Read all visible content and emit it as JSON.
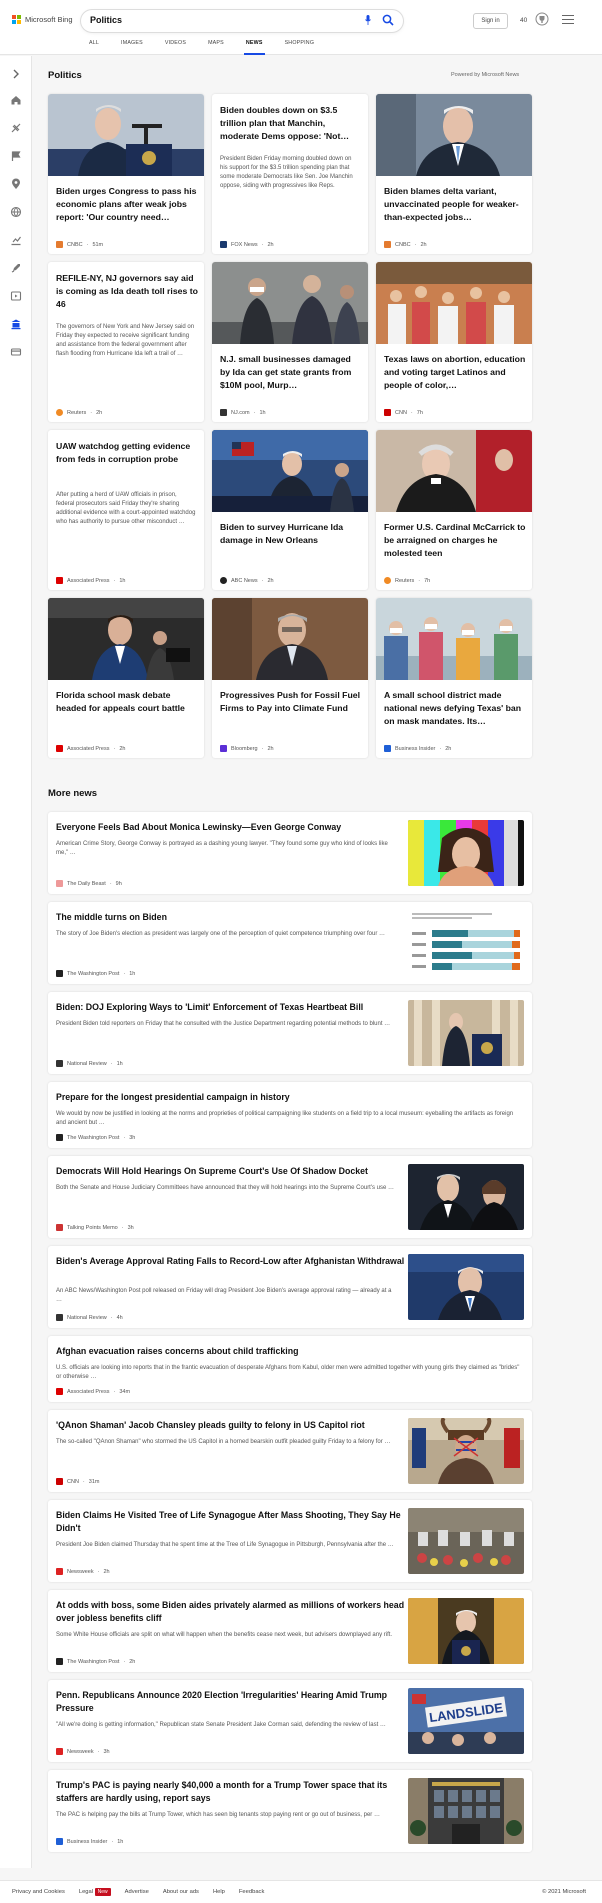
{
  "header": {
    "brand": "Microsoft Bing",
    "query": "Politics",
    "sign_in": "Sign in",
    "points": "40",
    "tabs": [
      "ALL",
      "IMAGES",
      "VIDEOS",
      "MAPS",
      "NEWS",
      "SHOPPING"
    ],
    "active_tab": "NEWS"
  },
  "section_title": "Politics",
  "powered_by": "Powered by Microsoft News",
  "cards": [
    {
      "title": "Biden urges Congress to pass his economic plans after weak jobs report: 'Our country need…",
      "source": "CNBC",
      "time": "51m",
      "icon_color": "#e47b2f"
    },
    {
      "title": "Biden doubles down on $3.5 trillion plan that Manchin, moderate Dems oppose: 'Not…",
      "snippet": "President Biden Friday morning doubled down on his support for the $3.5 trillion spending plan that some moderate Democrats like Sen. Joe Manchin oppose, siding with progressives like Reps.",
      "source": "FOX News",
      "time": "2h",
      "icon_color": "#1a3a6e"
    },
    {
      "title": "Biden blames delta variant, unvaccinated people for weaker-than-expected jobs…",
      "source": "CNBC",
      "time": "2h",
      "icon_color": "#e47b2f"
    },
    {
      "title": "REFILE-NY, NJ governors say aid is coming as Ida death toll rises to 46",
      "snippet": "The governors of New York and New Jersey said on Friday they expected to receive significant funding and assistance from the federal government after flash flooding from Hurricane Ida left a trail of …",
      "source": "Reuters",
      "time": "2h",
      "icon_color": "#f08a24"
    },
    {
      "title": "N.J. small businesses damaged by Ida can get state grants from $10M pool, Murp…",
      "source": "NJ.com",
      "time": "1h",
      "icon_color": "#333"
    },
    {
      "title": "Texas laws on abortion, education and voting target Latinos and people of color,…",
      "source": "CNN",
      "time": "7h",
      "icon_color": "#cc0000"
    },
    {
      "title": "UAW watchdog getting evidence from feds in corruption probe",
      "snippet": "After putting a herd of UAW officials in prison, federal prosecutors said Friday they're sharing additional evidence with a court-appointed watchdog who has authority to pursue other misconduct …",
      "source": "Associated Press",
      "time": "1h",
      "icon_color": "#d00"
    },
    {
      "title": "Biden to survey Hurricane Ida damage in New Orleans",
      "source": "ABC News",
      "time": "2h",
      "icon_color": "#222"
    },
    {
      "title": "Former U.S. Cardinal McCarrick to be arraigned on charges he molested teen",
      "source": "Reuters",
      "time": "7h",
      "icon_color": "#f08a24"
    },
    {
      "title": "Florida school mask debate headed for appeals court battle",
      "source": "Associated Press",
      "time": "2h",
      "icon_color": "#d00"
    },
    {
      "title": "Progressives Push for Fossil Fuel Firms to Pay into Climate Fund",
      "source": "Bloomberg",
      "time": "2h",
      "icon_color": "#5b2fd6"
    },
    {
      "title": "A small school district made national news defying Texas' ban on mask mandates. Its…",
      "source": "Business Insider",
      "time": "2h",
      "icon_color": "#1f5fd6"
    }
  ],
  "more_news_title": "More news",
  "more_news": [
    {
      "title": "Everyone Feels Bad About Monica Lewinsky—Even George Conway",
      "snippet": "American Crime Story, George Conway is portrayed as a dashing young lawyer. \"They found some guy who kind of looks like me,\" …",
      "source": "The Daily Beast",
      "time": "9h",
      "icon_color": "#e77"
    },
    {
      "title": "The middle turns on Biden",
      "snippet": "The story of Joe Biden's election as president was largely one of the perception of quiet competence triumphing over four …",
      "source": "The Washington Post",
      "time": "1h",
      "icon_color": "#222"
    },
    {
      "title": "Biden: DOJ Exploring Ways to 'Limit' Enforcement of Texas Heartbeat Bill",
      "snippet": "President Biden told reporters on Friday that he consulted with the Justice Department regarding potential methods to blunt …",
      "source": "National Review",
      "time": "1h",
      "icon_color": "#333"
    },
    {
      "title": "Prepare for the longest presidential campaign in history",
      "snippet": "We would by now be justified in looking at the norms and proprieties of political campaigning like students on a field trip to a local museum: eyeballing the artifacts as foreign and ancient but …",
      "source": "The Washington Post",
      "time": "3h",
      "icon_color": "#222"
    },
    {
      "title": "Democrats Will Hold Hearings On Supreme Court's Use Of Shadow Docket",
      "snippet": "Both the Senate and House Judiciary Committees have announced that they will hold hearings into the Supreme Court's use …",
      "source": "Talking Points Memo",
      "time": "3h",
      "icon_color": "#c33"
    },
    {
      "title": "Biden's Average Approval Rating Falls to Record-Low after Afghanistan Withdrawal",
      "snippet": "An ABC News/Washington Post poll released on Friday will drag President Joe Biden's average approval rating — already at a …",
      "source": "National Review",
      "time": "4h",
      "icon_color": "#333"
    },
    {
      "title": "Afghan evacuation raises concerns about child trafficking",
      "snippet": "U.S. officials are looking into reports that in the frantic evacuation of desperate Afghans from Kabul, older men were admitted together with young girls they claimed as \"brides\" or otherwise …",
      "source": "Associated Press",
      "time": "34m",
      "icon_color": "#d00"
    },
    {
      "title": "'QAnon Shaman' Jacob Chansley pleads guilty to felony in US Capitol riot",
      "snippet": "The so-called \"QAnon Shaman\" who stormed the US Capitol in a horned bearskin outfit pleaded guilty Friday to a felony for …",
      "source": "CNN",
      "time": "31m",
      "icon_color": "#cc0000"
    },
    {
      "title": "Biden Claims He Visited Tree of Life Synagogue After Mass Shooting, They Say He Didn't",
      "snippet": "President Joe Biden claimed Thursday that he spent time at the Tree of Life Synagogue in Pittsburgh, Pennsylvania after the …",
      "source": "Newsweek",
      "time": "2h",
      "icon_color": "#d22"
    },
    {
      "title": "At odds with boss, some Biden aides privately alarmed as millions of workers head over jobless benefits cliff",
      "snippet": "Some White House officials are split on what will happen when the benefits cease next week, but advisers downplayed any rift.",
      "source": "The Washington Post",
      "time": "2h",
      "icon_color": "#222"
    },
    {
      "title": "Penn. Republicans Announce 2020 Election 'Irregularities' Hearing Amid Trump Pressure",
      "snippet": "\"All we're doing is getting information,\" Republican state Senate President Jake Corman said, defending the review of last …",
      "source": "Newsweek",
      "time": "3h",
      "icon_color": "#d22"
    },
    {
      "title": "Trump's PAC is paying nearly $40,000 a month for a Trump Tower space that its staffers are hardly using, report says",
      "snippet": "The PAC is helping pay the bills at Trump Tower, which has seen big tenants stop paying rent or go out of business, per …",
      "source": "Business Insider",
      "time": "1h",
      "icon_color": "#1f5fd6"
    }
  ],
  "thumb_text": {
    "landslide": "LANDSLIDE"
  },
  "footer": {
    "links": [
      "Privacy and Cookies",
      "Legal",
      "Advertise",
      "About our ads",
      "Help",
      "Feedback"
    ],
    "new_badge": "New",
    "copyright": "© 2021 Microsoft"
  }
}
